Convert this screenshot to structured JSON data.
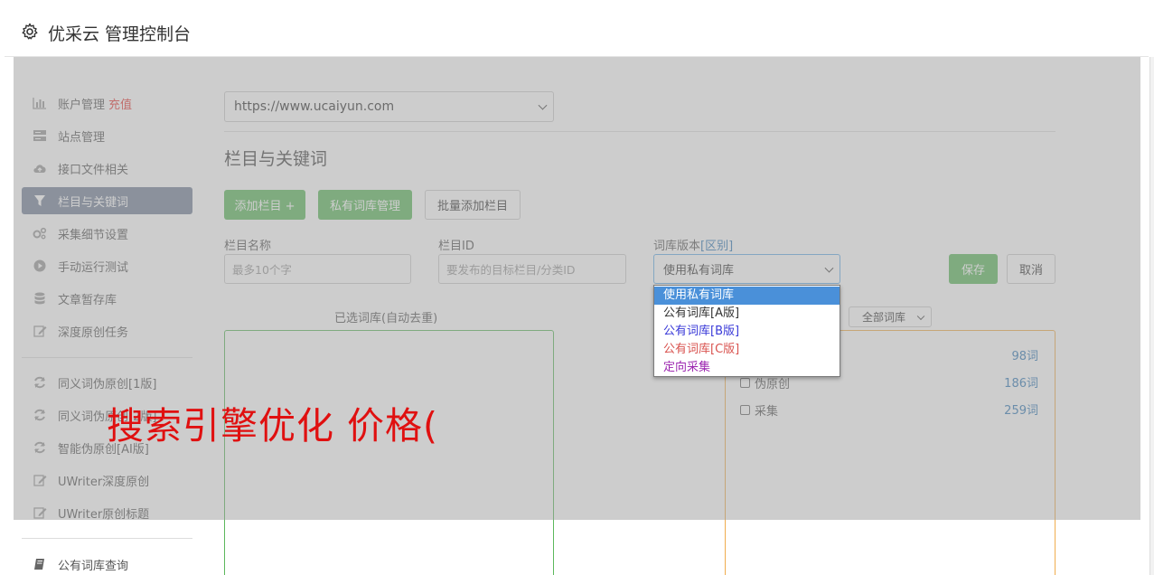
{
  "header": {
    "title": "优采云 管理控制台"
  },
  "sidebar": {
    "group1": [
      {
        "label": "账户管理",
        "extra": "充值",
        "icon": "bar-chart-icon"
      },
      {
        "label": "站点管理",
        "icon": "server-icon"
      },
      {
        "label": "接口文件相关",
        "icon": "cloud-upload-icon"
      },
      {
        "label": "栏目与关键词",
        "icon": "filter-icon",
        "active": true
      },
      {
        "label": "采集细节设置",
        "icon": "gears-icon"
      },
      {
        "label": "手动运行测试",
        "icon": "play-circle-icon"
      },
      {
        "label": "文章暂存库",
        "icon": "database-icon"
      },
      {
        "label": "深度原创任务",
        "icon": "edit-icon"
      }
    ],
    "group2": [
      {
        "label": "同义词伪原创[1版]",
        "icon": "refresh-icon"
      },
      {
        "label": "同义词伪原创[2版]",
        "icon": "refresh-icon"
      },
      {
        "label": "智能伪原创[AI版]",
        "icon": "refresh-icon"
      },
      {
        "label": "UWriter深度原创",
        "icon": "edit-icon"
      },
      {
        "label": "UWriter原创标题",
        "icon": "edit-icon"
      }
    ],
    "group3": [
      {
        "label": "公有词库查询",
        "icon": "book-icon"
      }
    ]
  },
  "content": {
    "site_select": "https://www.ucaiyun.com",
    "section_title": "栏目与关键词",
    "buttons": {
      "add_column": "添加栏目 +",
      "private_lib": "私有词库管理",
      "batch_add": "批量添加栏目",
      "save": "保存",
      "cancel": "取消"
    },
    "form": {
      "name_label": "栏目名称",
      "name_placeholder": "最多10个字",
      "id_label": "栏目ID",
      "id_placeholder": "要发布的目标栏目/分类ID",
      "version_label": "词库版本",
      "version_link": "[区别]",
      "version_value": "使用私有词库"
    },
    "version_options": [
      "使用私有词库",
      "公有词库[A版]",
      "公有词库[B版]",
      "公有词库[C版]",
      "定向采集"
    ],
    "selected_lib_title": "已选词库(自动去重)",
    "all_lib_filter": "全部词库",
    "lib_list": [
      {
        "name": "",
        "count": "98词"
      },
      {
        "name": "伪原创",
        "count": "186词"
      },
      {
        "name": "采集",
        "count": "259词"
      }
    ]
  },
  "overlay_text": "搜索引擎优化 价格(",
  "colors": {
    "accent_green": "#5cb85c",
    "active_nav": "#75839a",
    "link_blue": "#337ab7",
    "overlay_red": "#e01010"
  }
}
